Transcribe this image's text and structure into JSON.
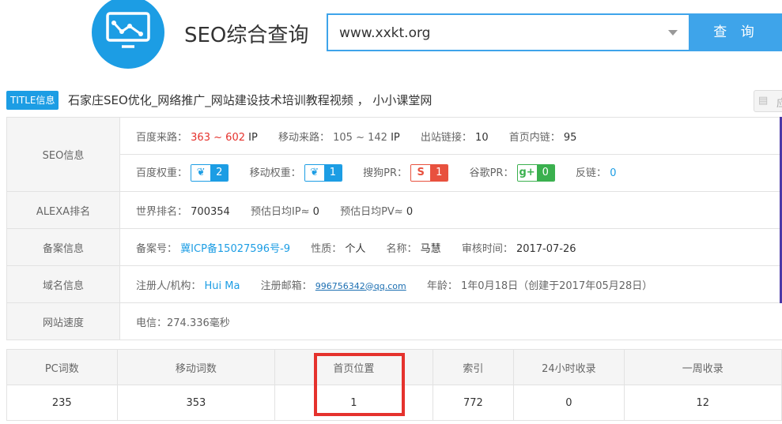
{
  "header": {
    "app_title": "SEO综合查询",
    "search_value": "www.xxkt.org",
    "query_button": "查 询"
  },
  "title_info": {
    "badge": "TITLE信息",
    "text": "石家庄SEO优化_网络推广_网站建设技术培训教程视频 ， 小小课堂网",
    "side_button": "应"
  },
  "seo": {
    "label": "SEO信息",
    "baidu_source_label": "百度来路：",
    "baidu_source_low": "363",
    "baidu_source_sep": "~",
    "baidu_source_high": "602",
    "baidu_source_unit": "IP",
    "mobile_source_label": "移动来路：",
    "mobile_source_value": "105 ~ 142",
    "mobile_source_unit": "IP",
    "outbound_label": "出站链接：",
    "outbound_value": "10",
    "homepage_links_label": "首页内链：",
    "homepage_links_value": "95",
    "baidu_weight_label": "百度权重：",
    "baidu_weight_value": "2",
    "mobile_weight_label": "移动权重：",
    "mobile_weight_value": "1",
    "sogou_pr_label": "搜狗PR：",
    "sogou_pr_value": "1",
    "google_pr_label": "谷歌PR：",
    "google_pr_value": "0",
    "backlinks_label": "反链：",
    "backlinks_value": "0"
  },
  "alexa": {
    "label": "ALEXA排名",
    "world_rank_label": "世界排名：",
    "world_rank_value": "700354",
    "est_ip_label": "预估日均IP≈",
    "est_ip_value": "0",
    "est_pv_label": "预估日均PV≈",
    "est_pv_value": "0"
  },
  "beian": {
    "label": "备案信息",
    "number_label": "备案号：",
    "number_value": "冀ICP备15027596号-9",
    "nature_label": "性质：",
    "nature_value": "个人",
    "name_label": "名称：",
    "name_value": "马慧",
    "review_label": "审核时间：",
    "review_value": "2017-07-26"
  },
  "domain": {
    "label": "域名信息",
    "registrant_label": "注册人/机构：",
    "registrant_value": "Hui Ma",
    "email_label": "注册邮箱：",
    "email_value": "996756342@qq.com",
    "age_label": "年龄：",
    "age_value": "1年0月18日",
    "created_note": "（创建于2017年05月28日）"
  },
  "speed": {
    "label": "网站速度",
    "value": "电信：274.336毫秒"
  },
  "stats": {
    "headers": [
      "PC词数",
      "移动词数",
      "首页位置",
      "索引",
      "24小时收录",
      "一周收录"
    ],
    "values": [
      "235",
      "353",
      "1",
      "772",
      "0",
      "12"
    ]
  },
  "colors": {
    "accent": "#1c9de4",
    "red": "#e5322d",
    "sogou": "#e8513e",
    "google": "#3ab04e"
  },
  "icons": [
    "chart-line-icon",
    "caret-down-icon",
    "paw-icon",
    "sogou-icon",
    "google-plus-icon",
    "stack-icon"
  ]
}
